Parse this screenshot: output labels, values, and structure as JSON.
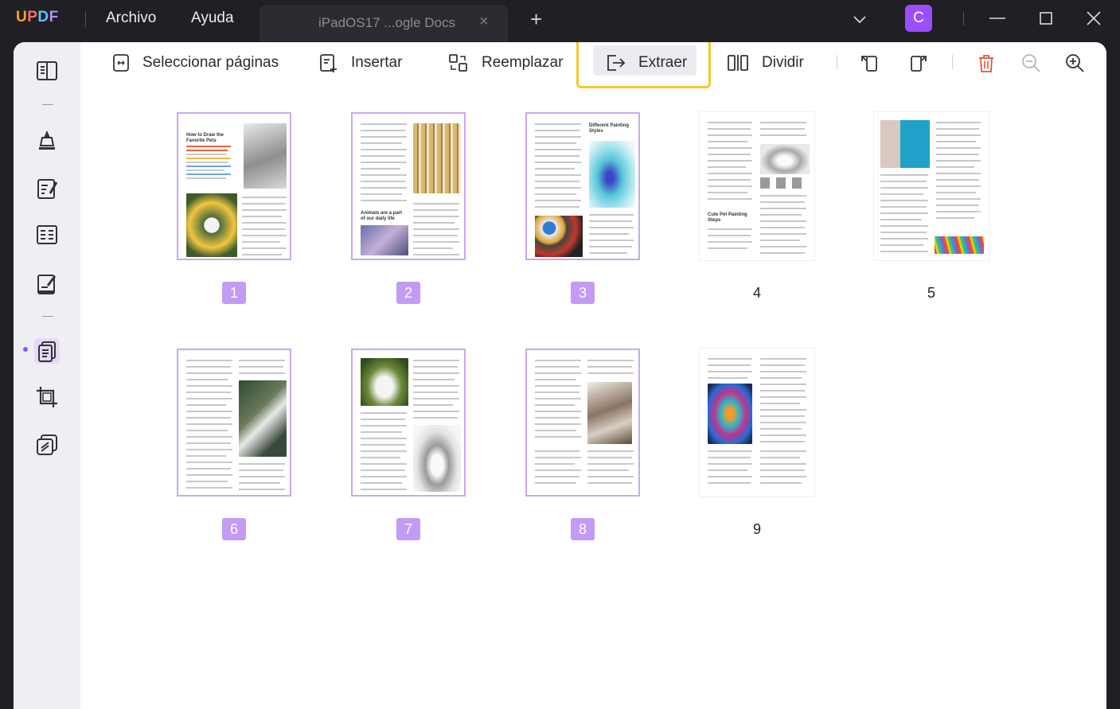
{
  "app": {
    "logo": "UPDF",
    "menu": [
      "Archivo",
      "Ayuda"
    ],
    "tab_title": "iPadOS17 ...ogle Docs",
    "tab_close": "×",
    "new_tab": "+",
    "avatar_letter": "C"
  },
  "toolbar": {
    "select_pages": "Seleccionar páginas",
    "insert": "Insertar",
    "replace": "Reemplazar",
    "extract": "Extraer",
    "split": "Dividir"
  },
  "pages": [
    {
      "number": "1",
      "selected": true,
      "title": "How to Draw the Favorite Pets"
    },
    {
      "number": "2",
      "selected": true,
      "title": "Animals are a part of our daily life"
    },
    {
      "number": "3",
      "selected": true,
      "title": "Different Painting Styles"
    },
    {
      "number": "4",
      "selected": false,
      "title": "Cute Pet Painting Steps"
    },
    {
      "number": "5",
      "selected": false
    },
    {
      "number": "6",
      "selected": true
    },
    {
      "number": "7",
      "selected": true
    },
    {
      "number": "8",
      "selected": true
    },
    {
      "number": "9",
      "selected": false
    }
  ],
  "colors": {
    "accent": "#c39bf5",
    "highlight": "#f7c72c",
    "avatar": "#9b4dff",
    "delete": "#e5533d"
  }
}
